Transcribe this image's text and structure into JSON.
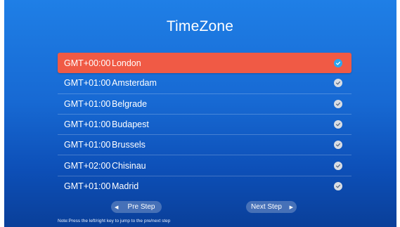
{
  "title": "TimeZone",
  "zones": [
    {
      "offset": "GMT+00:00",
      "city": "London",
      "selected": true
    },
    {
      "offset": "GMT+01:00",
      "city": "Amsterdam",
      "selected": false
    },
    {
      "offset": "GMT+01:00",
      "city": "Belgrade",
      "selected": false
    },
    {
      "offset": "GMT+01:00",
      "city": "Budapest",
      "selected": false
    },
    {
      "offset": "GMT+01:00",
      "city": "Brussels",
      "selected": false
    },
    {
      "offset": "GMT+02:00",
      "city": "Chisinau",
      "selected": false
    },
    {
      "offset": "GMT+01:00",
      "city": "Madrid",
      "selected": false
    }
  ],
  "buttons": {
    "pre": "Pre Step",
    "next": "Next Step"
  },
  "note": "Note:Press the left/right key to jump to the pre/next step",
  "colors": {
    "selected_row": "#f05a45",
    "selected_check": "#2aa7f0",
    "check": "#d9dde3"
  }
}
